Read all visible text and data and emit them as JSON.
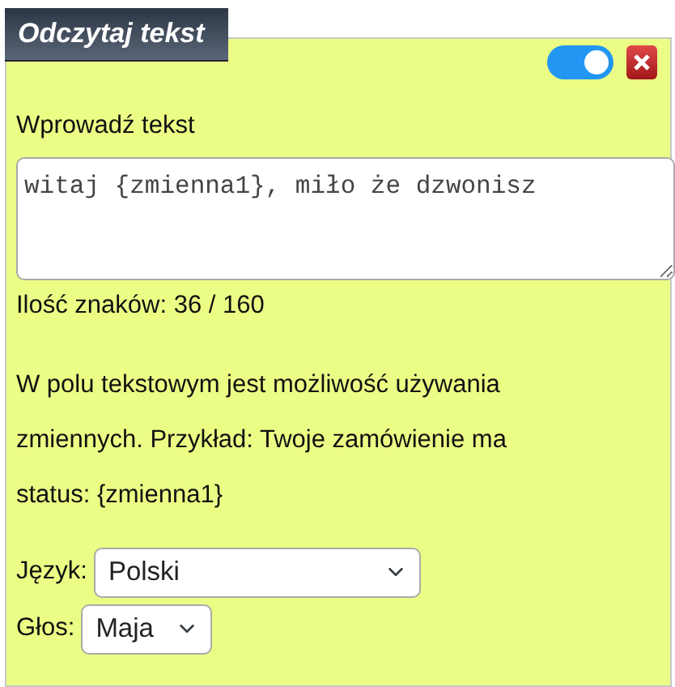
{
  "title": "Odczytaj tekst",
  "toggle": {
    "on": true
  },
  "text_field": {
    "label": "Wprowadź tekst",
    "value": "witaj {zmienna1}, miło że dzwonisz"
  },
  "counter": "Ilość znaków: 36 / 160",
  "hint": "W polu tekstowym jest możliwość używania zmiennych. Przykład: Twoje zamówienie ma status: {zmienna1}",
  "selects": [
    {
      "label": "Język:",
      "value": "Polski"
    },
    {
      "label": "Głos:",
      "value": "Maja"
    }
  ]
}
